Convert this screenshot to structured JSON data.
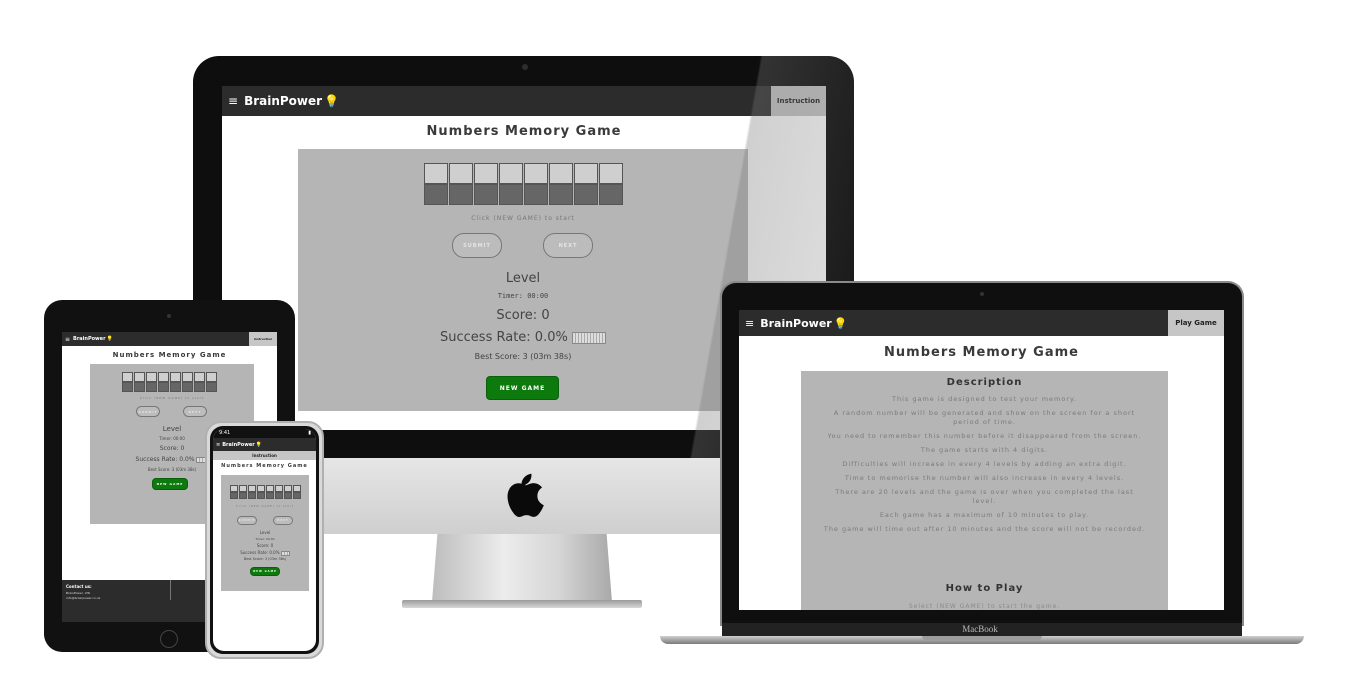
{
  "brand": "BrainPower",
  "nav": {
    "instruction": "Instruction",
    "play_game": "Play Game"
  },
  "game": {
    "title": "Numbers Memory Game",
    "message": "Click (NEW GAME) to start",
    "submit": "SUBMIT",
    "next": "NEXT",
    "level": "Level",
    "timer": "Timer: 00:00",
    "score": "Score: 0",
    "success_rate": "Success Rate: 0.0%",
    "best_score": "Best Score: 3 (03m 38s)",
    "new_game": "NEW GAME",
    "digit_count": 8
  },
  "instructions": {
    "description_heading": "Description",
    "lines": [
      "This game is designed to test your memory.",
      "A random number will be generated and show on the screen for a short period of time.",
      "You need to remember this number before it disappeared from the screen.",
      "The game starts with 4 digits.",
      "Difficulties will increase in every 4 levels by adding an extra digit.",
      "Time to memorise the number will also increase in every 4 levels.",
      "There are 20 levels and the game is over when you completed the last level.",
      "Each game has a maximum of 10 minutes to play.",
      "The game will time out after 10 minutes and the score will not be recorded."
    ],
    "how_to_play_heading": "How to Play",
    "how_to_play_first": "Select (NEW GAME) to start the game."
  },
  "footer": {
    "contact": "Contact us:",
    "company": "BrainPower, LTD",
    "email": "info@brainpower.co.uk"
  },
  "iphone_status": {
    "time": "9:41"
  },
  "macbook_label": "MacBook",
  "colors": {
    "nav": "#2c2c2c",
    "panel": "#b5b5b5",
    "new_game": "#0c7a0c"
  }
}
